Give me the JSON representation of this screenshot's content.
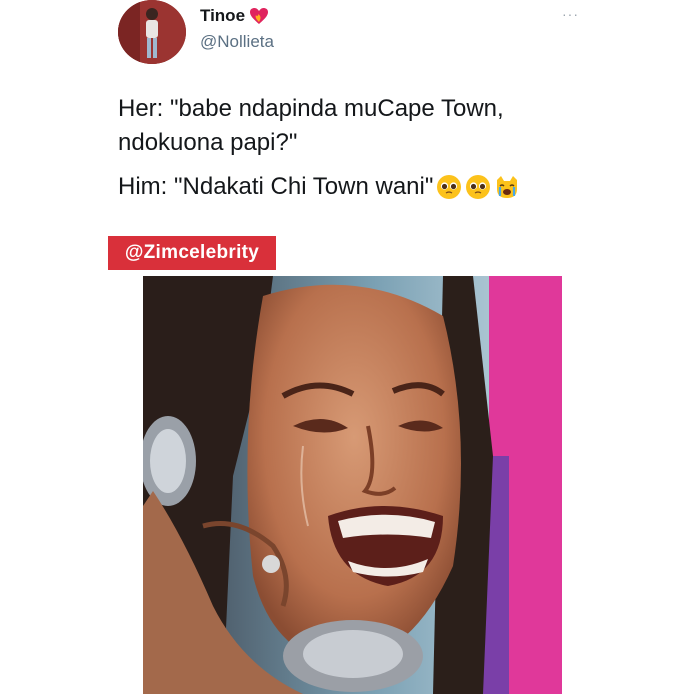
{
  "tweet": {
    "display_name": "Tinoe",
    "handle": "@Nollieta",
    "more_label": "···",
    "text": {
      "line1": "Her: \"babe ndapinda muCape Town,",
      "line2": "ndokuona papi?\"",
      "line3": "Him: \"Ndakati Chi Town wani\""
    },
    "emojis": [
      "pleading-face-icon",
      "pleading-face-icon",
      "crying-cat-icon"
    ],
    "name_badge_icon": "heart-on-fire-icon"
  },
  "watermark": {
    "label": "@Zimcelebrity",
    "color": "#d9303a"
  },
  "meme_image": {
    "subject": "crying-woman-on-phone"
  }
}
